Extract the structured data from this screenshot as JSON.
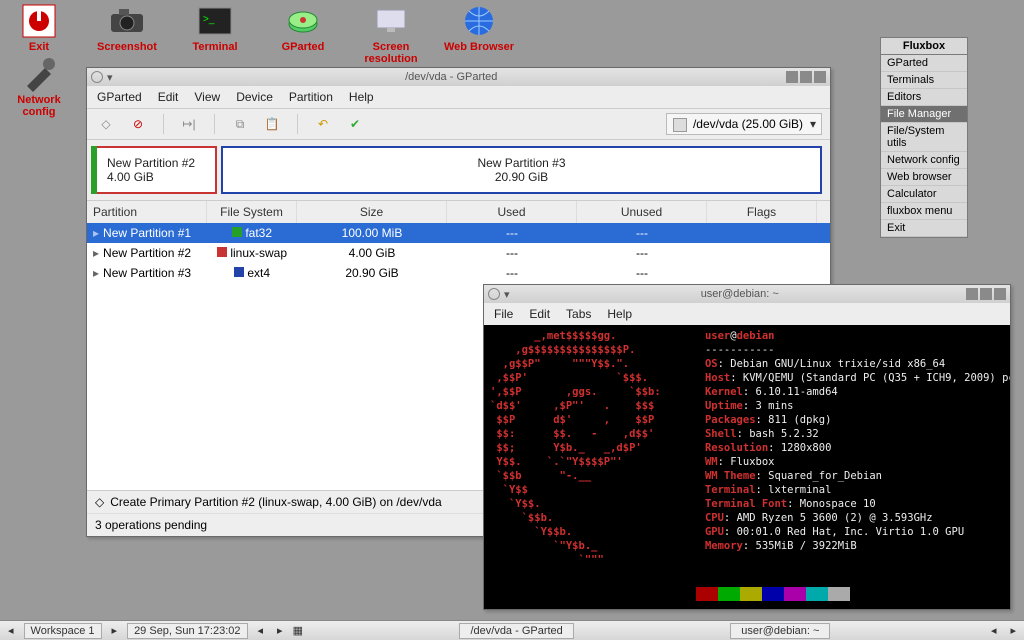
{
  "desktop_icons": {
    "exit": "Exit",
    "screenshot": "Screenshot",
    "terminal": "Terminal",
    "gparted": "GParted",
    "screenres": "Screen resolution",
    "browser": "Web Browser",
    "netconfig": "Network config"
  },
  "fluxbox_menu": {
    "title": "Fluxbox",
    "items": [
      "GParted",
      "Terminals",
      "Editors",
      "File Manager",
      "File/System utils",
      "Network config",
      "Web browser",
      "Calculator",
      "fluxbox menu",
      "Exit"
    ],
    "selected_index": 3
  },
  "gparted": {
    "title": "/dev/vda - GParted",
    "menu": [
      "GParted",
      "Edit",
      "View",
      "Device",
      "Partition",
      "Help"
    ],
    "device_selector": "/dev/vda  (25.00 GiB)",
    "disk_parts": {
      "p2_name": "New Partition #2",
      "p2_size": "4.00 GiB",
      "p3_name": "New Partition #3",
      "p3_size": "20.90 GiB"
    },
    "columns": [
      "Partition",
      "File System",
      "Size",
      "Used",
      "Unused",
      "Flags"
    ],
    "rows": [
      {
        "name": "New Partition #1",
        "fs": "fat32",
        "fs_color": "#26a02a",
        "size": "100.00 MiB",
        "used": "---",
        "unused": "---",
        "flags": "",
        "selected": true
      },
      {
        "name": "New Partition #2",
        "fs": "linux-swap",
        "fs_color": "#c83333",
        "size": "4.00 GiB",
        "used": "---",
        "unused": "---",
        "flags": ""
      },
      {
        "name": "New Partition #3",
        "fs": "ext4",
        "fs_color": "#2244aa",
        "size": "20.90 GiB",
        "used": "---",
        "unused": "---",
        "flags": ""
      }
    ],
    "status_op": "Create Primary Partition #2 (linux-swap, 4.00 GiB) on /dev/vda",
    "pending": "3 operations pending"
  },
  "terminal": {
    "title": "user@debian: ~",
    "menu": [
      "File",
      "Edit",
      "Tabs",
      "Help"
    ],
    "prompt_user": "user",
    "prompt_at": "@",
    "prompt_host": "debian",
    "info": {
      "sep": "-----------",
      "OS": "Debian GNU/Linux trixie/sid x86_64",
      "Host": "KVM/QEMU (Standard PC (Q35 + ICH9, 2009) pc",
      "Kernel": "6.10.11-amd64",
      "Uptime": "3 mins",
      "Packages": "811 (dpkg)",
      "Shell": "bash 5.2.32",
      "Resolution": "1280x800",
      "WM": "Fluxbox",
      "WM Theme": "Squared_for_Debian",
      "Terminal": "lxterminal",
      "Terminal Font": "Monospace 10",
      "CPU": "AMD Ryzen 5 3600 (2) @ 3.593GHz",
      "GPU": "00:01.0 Red Hat, Inc. Virtio 1.0 GPU",
      "Memory": "535MiB / 3922MiB"
    },
    "ascii": "       _,met$$$$$gg.\n    ,g$$$$$$$$$$$$$$$P.\n  ,g$$P\"     \"\"\"Y$$.\".\n ,$$P'              `$$$.\n',$$P       ,ggs.     `$$b:\n`d$$'     ,$P\"'   .    $$$\n $$P      d$'     ,    $$P\n $$:      $$.   -    ,d$$'\n $$;      Y$b._   _,d$P'\n Y$$.    `.`\"Y$$$$P\"'\n `$$b      \"-.__\n  `Y$$\n   `Y$$.\n     `$$b.\n       `Y$$b.\n          `\"Y$b._\n              `\"\"\""
  },
  "taskbar": {
    "workspace": "Workspace 1",
    "clock": "29 Sep, Sun 17:23:02",
    "tasks": [
      "/dev/vda - GParted",
      "user@debian: ~"
    ]
  }
}
